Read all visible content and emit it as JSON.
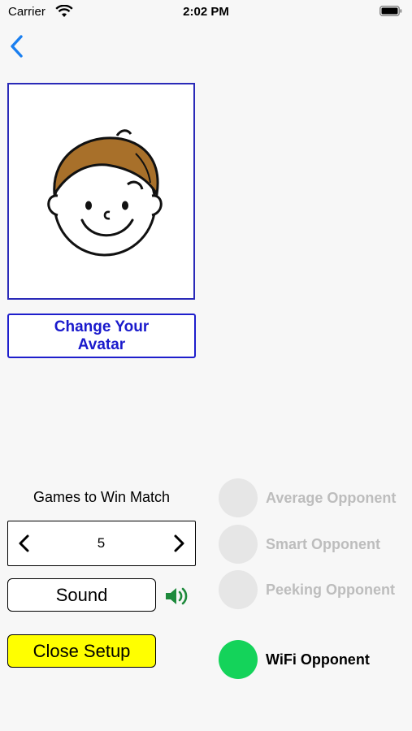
{
  "status_bar": {
    "carrier": "Carrier",
    "time": "2:02 PM"
  },
  "avatar": {
    "change_label": "Change Your Avatar"
  },
  "games": {
    "label": "Games to Win Match",
    "value": "5"
  },
  "sound": {
    "label": "Sound",
    "enabled": true
  },
  "close": {
    "label": "Close Setup"
  },
  "opponents": [
    {
      "label": "Average Opponent",
      "selected": false
    },
    {
      "label": "Smart Opponent",
      "selected": false
    },
    {
      "label": "Peeking Opponent",
      "selected": false
    },
    {
      "label": "WiFi Opponent",
      "selected": true
    }
  ],
  "colors": {
    "accent_blue": "#1a1acc",
    "close_yellow": "#ffff00",
    "active_green": "#14d35a",
    "back_blue": "#1a7ff0"
  }
}
